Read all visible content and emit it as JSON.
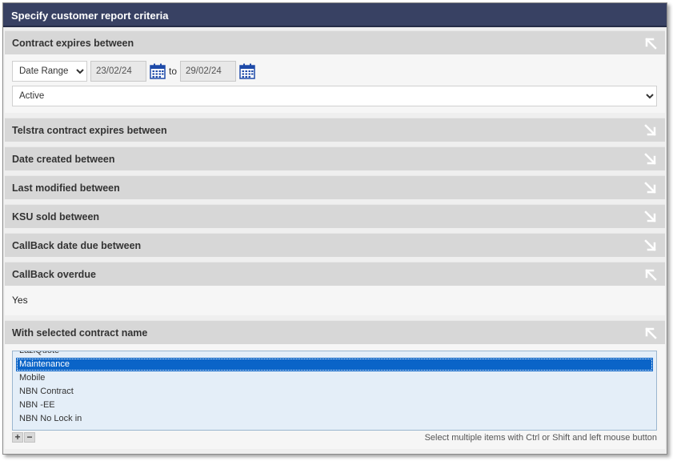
{
  "dialog": {
    "title": "Specify customer report criteria"
  },
  "contract_expires": {
    "title": "Contract expires between",
    "range_select": "Date Range",
    "from_date": "23/02/24",
    "to_label": "to",
    "to_date": "29/02/24",
    "status_select": "Active"
  },
  "collapsed_sections": [
    {
      "title": "Telstra contract expires between"
    },
    {
      "title": "Date created between"
    },
    {
      "title": "Last modified between"
    },
    {
      "title": "KSU sold between"
    },
    {
      "title": "CallBack date due between"
    }
  ],
  "callback_overdue": {
    "title": "CallBack overdue",
    "value": "Yes"
  },
  "contract_name": {
    "title": "With selected contract name",
    "items": [
      "LaziQuote",
      "Maintenance",
      "Mobile",
      "NBN Contract",
      "NBN -EE",
      "NBN No Lock in"
    ],
    "selected": "Maintenance",
    "hint": "Select multiple items with Ctrl or Shift and left mouse button",
    "add_label": "+",
    "remove_label": "−"
  },
  "icons": {
    "collapse": "arrow-up-left-icon",
    "expand": "arrow-down-right-icon",
    "calendar": "calendar-icon"
  },
  "colors": {
    "header_bg": "#384163",
    "section_bg": "#d7d7d7",
    "selected_bg": "#0a64c8",
    "calendar": "#1e4aa8"
  }
}
